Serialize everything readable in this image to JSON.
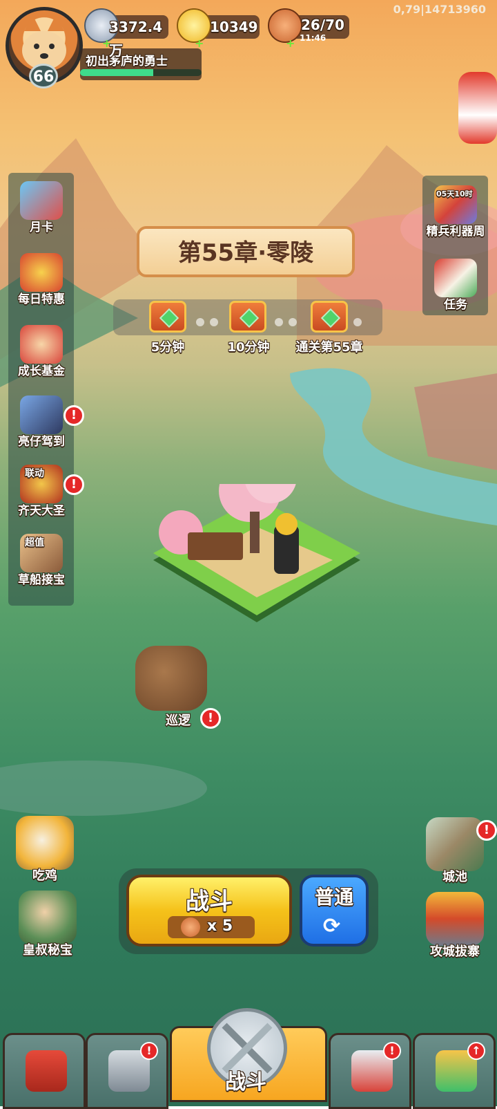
{
  "debug_text": "0,79|14713960",
  "player": {
    "level": "66",
    "title": "初出茅庐的勇士",
    "exp_progress": 0.6
  },
  "resources": {
    "silver": "3372.4万",
    "gold": "10349",
    "stamina": "26/70",
    "stamina_timer": "11:46"
  },
  "left_menu": [
    {
      "label": "月卡",
      "icon": "month-card-icon",
      "alert": false
    },
    {
      "label": "每日特惠",
      "icon": "daily-deal-bag-icon",
      "alert": false
    },
    {
      "label": "成长基金",
      "icon": "growth-fund-icon",
      "alert": false
    },
    {
      "label": "亮仔驾到",
      "icon": "liangzai-arrives-icon",
      "alert": true
    },
    {
      "label": "齐天大圣",
      "icon": "monkey-king-icon",
      "alert": true,
      "tag": "联动"
    },
    {
      "label": "草船接宝",
      "icon": "straw-boat-treasure-icon",
      "alert": false,
      "tag": "超值"
    }
  ],
  "right_menu": [
    {
      "label": "精兵利器周",
      "icon": "elite-weapons-week-icon",
      "timer": "05天10时"
    },
    {
      "label": "任务",
      "icon": "quest-scroll-icon"
    }
  ],
  "chapter": {
    "title": "第55章·零陵",
    "rewards": [
      {
        "label": "5分钟"
      },
      {
        "label": "10分钟"
      },
      {
        "label": "通关第55章"
      }
    ]
  },
  "patrol": {
    "label": "巡逻",
    "alert": true
  },
  "bottom_left": [
    {
      "label": "吃鸡",
      "icon": "chicken-dinner-icon"
    },
    {
      "label": "皇叔秘宝",
      "icon": "uncle-treasure-icon"
    }
  ],
  "bottom_right": [
    {
      "label": "城池",
      "icon": "city-icon",
      "alert": true
    },
    {
      "label": "攻城拔寨",
      "icon": "siege-gate-icon"
    }
  ],
  "battle": {
    "button_label": "战斗",
    "cost": "x 5",
    "mode_label": "普通"
  },
  "nav": {
    "active_label": "战斗",
    "tabs": [
      {
        "name": "city-gate-icon",
        "alert": false
      },
      {
        "name": "helmet-icon",
        "alert": true
      },
      {
        "name": "crossed-swords-icon",
        "active": true
      },
      {
        "name": "feather-stars-icon",
        "alert": true
      },
      {
        "name": "fist-upgrade-icon",
        "upgrade": true
      }
    ]
  },
  "colors": {
    "accent_gold": "#f5c21a",
    "mode_blue": "#1f6fe5",
    "alert_red": "#e52828",
    "exp_green": "#3fdc8b"
  }
}
